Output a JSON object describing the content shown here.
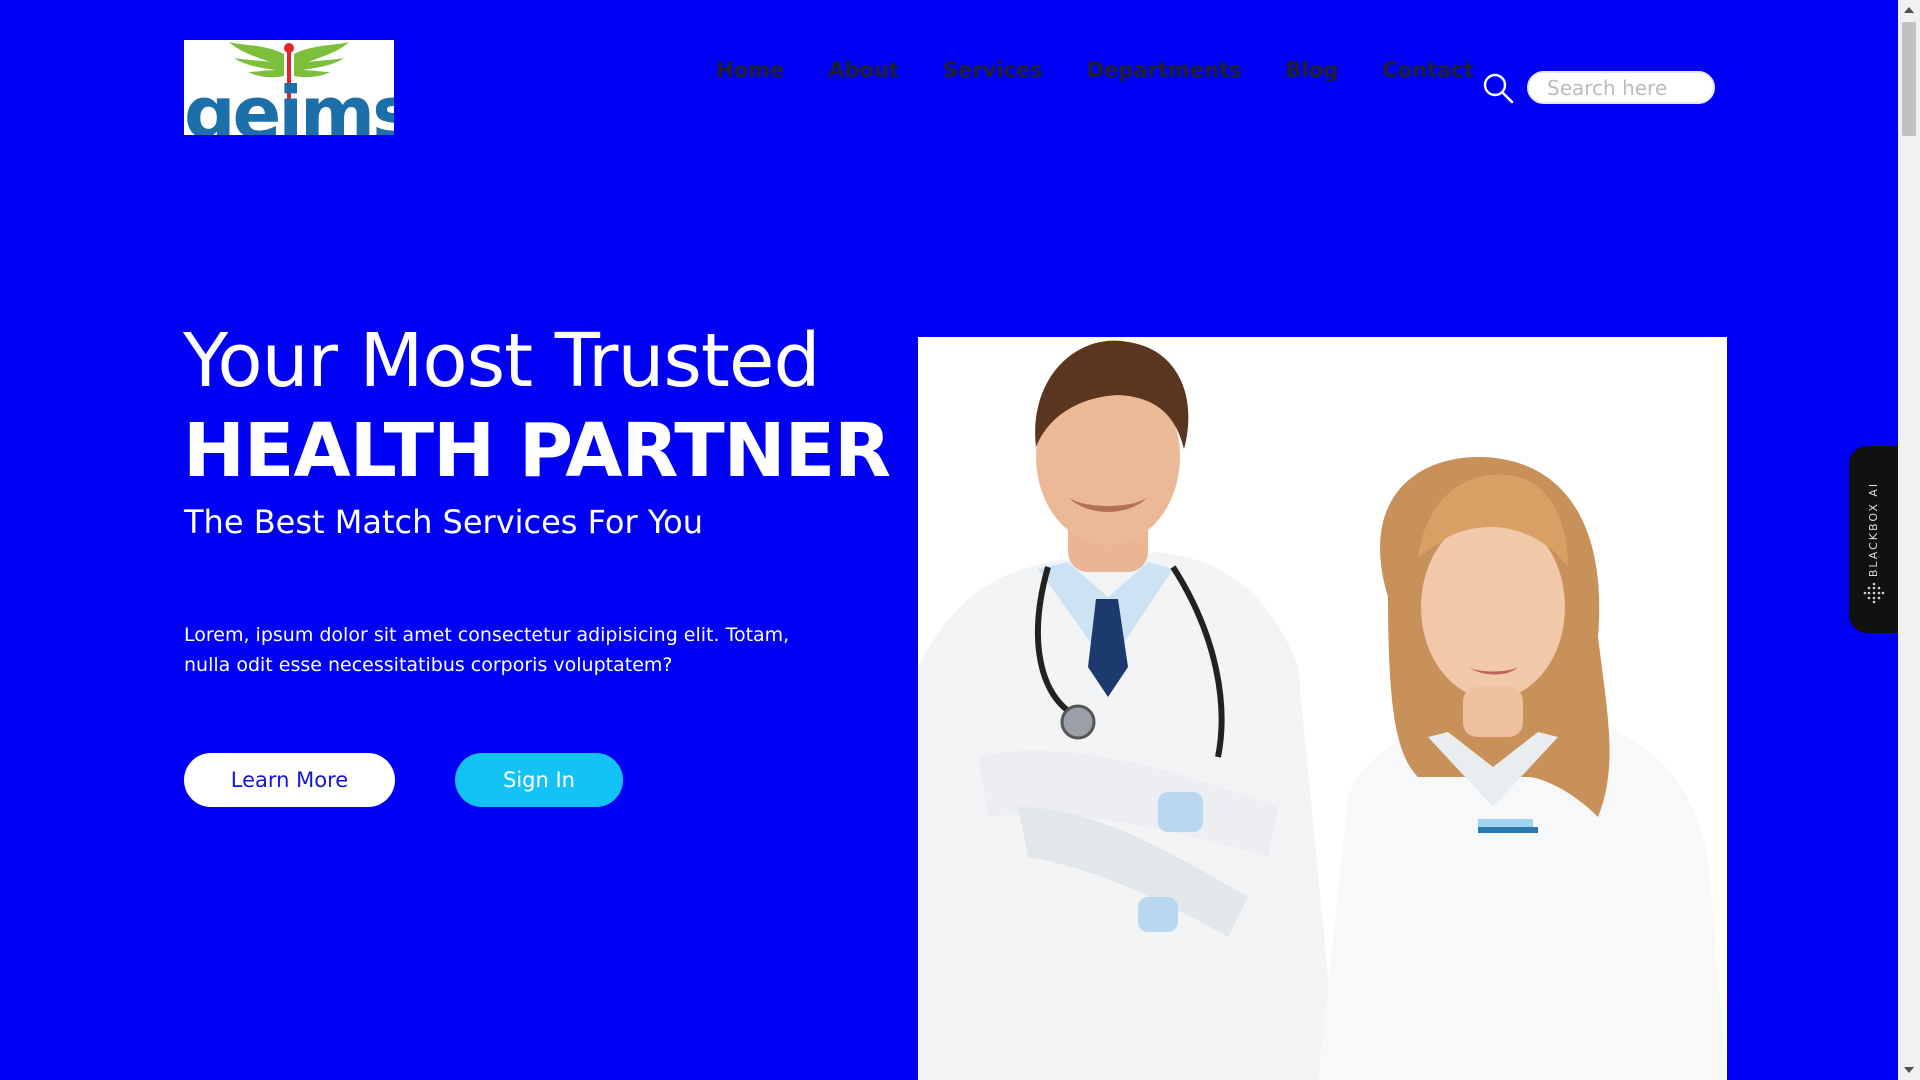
{
  "brand": {
    "logo_text": "geims"
  },
  "nav": {
    "items": [
      {
        "label": "Home"
      },
      {
        "label": "About"
      },
      {
        "label": "Services"
      },
      {
        "label": "Departments"
      },
      {
        "label": "Blog"
      },
      {
        "label": "Contact"
      }
    ]
  },
  "search": {
    "placeholder": "Search here",
    "icon": "search-icon"
  },
  "hero": {
    "title_line1": "Your Most Trusted",
    "title_line2": "HEALTH PARTNER",
    "subtitle": "The Best Match Services For You",
    "description": "Lorem, ipsum dolor sit amet consectetur adipisicing elit. Totam, nulla odit esse necessitatibus corporis voluptatem?",
    "learn_more_label": "Learn More",
    "sign_in_label": "Sign In"
  },
  "side_tab": {
    "label": "BLACKBOX AI"
  },
  "colors": {
    "background": "#0000f5",
    "accent": "#14c3f5",
    "nav_text": "#20202a",
    "logo_blue": "#1c6fa8",
    "logo_green": "#7cbf3a",
    "logo_red": "#e0262b"
  }
}
